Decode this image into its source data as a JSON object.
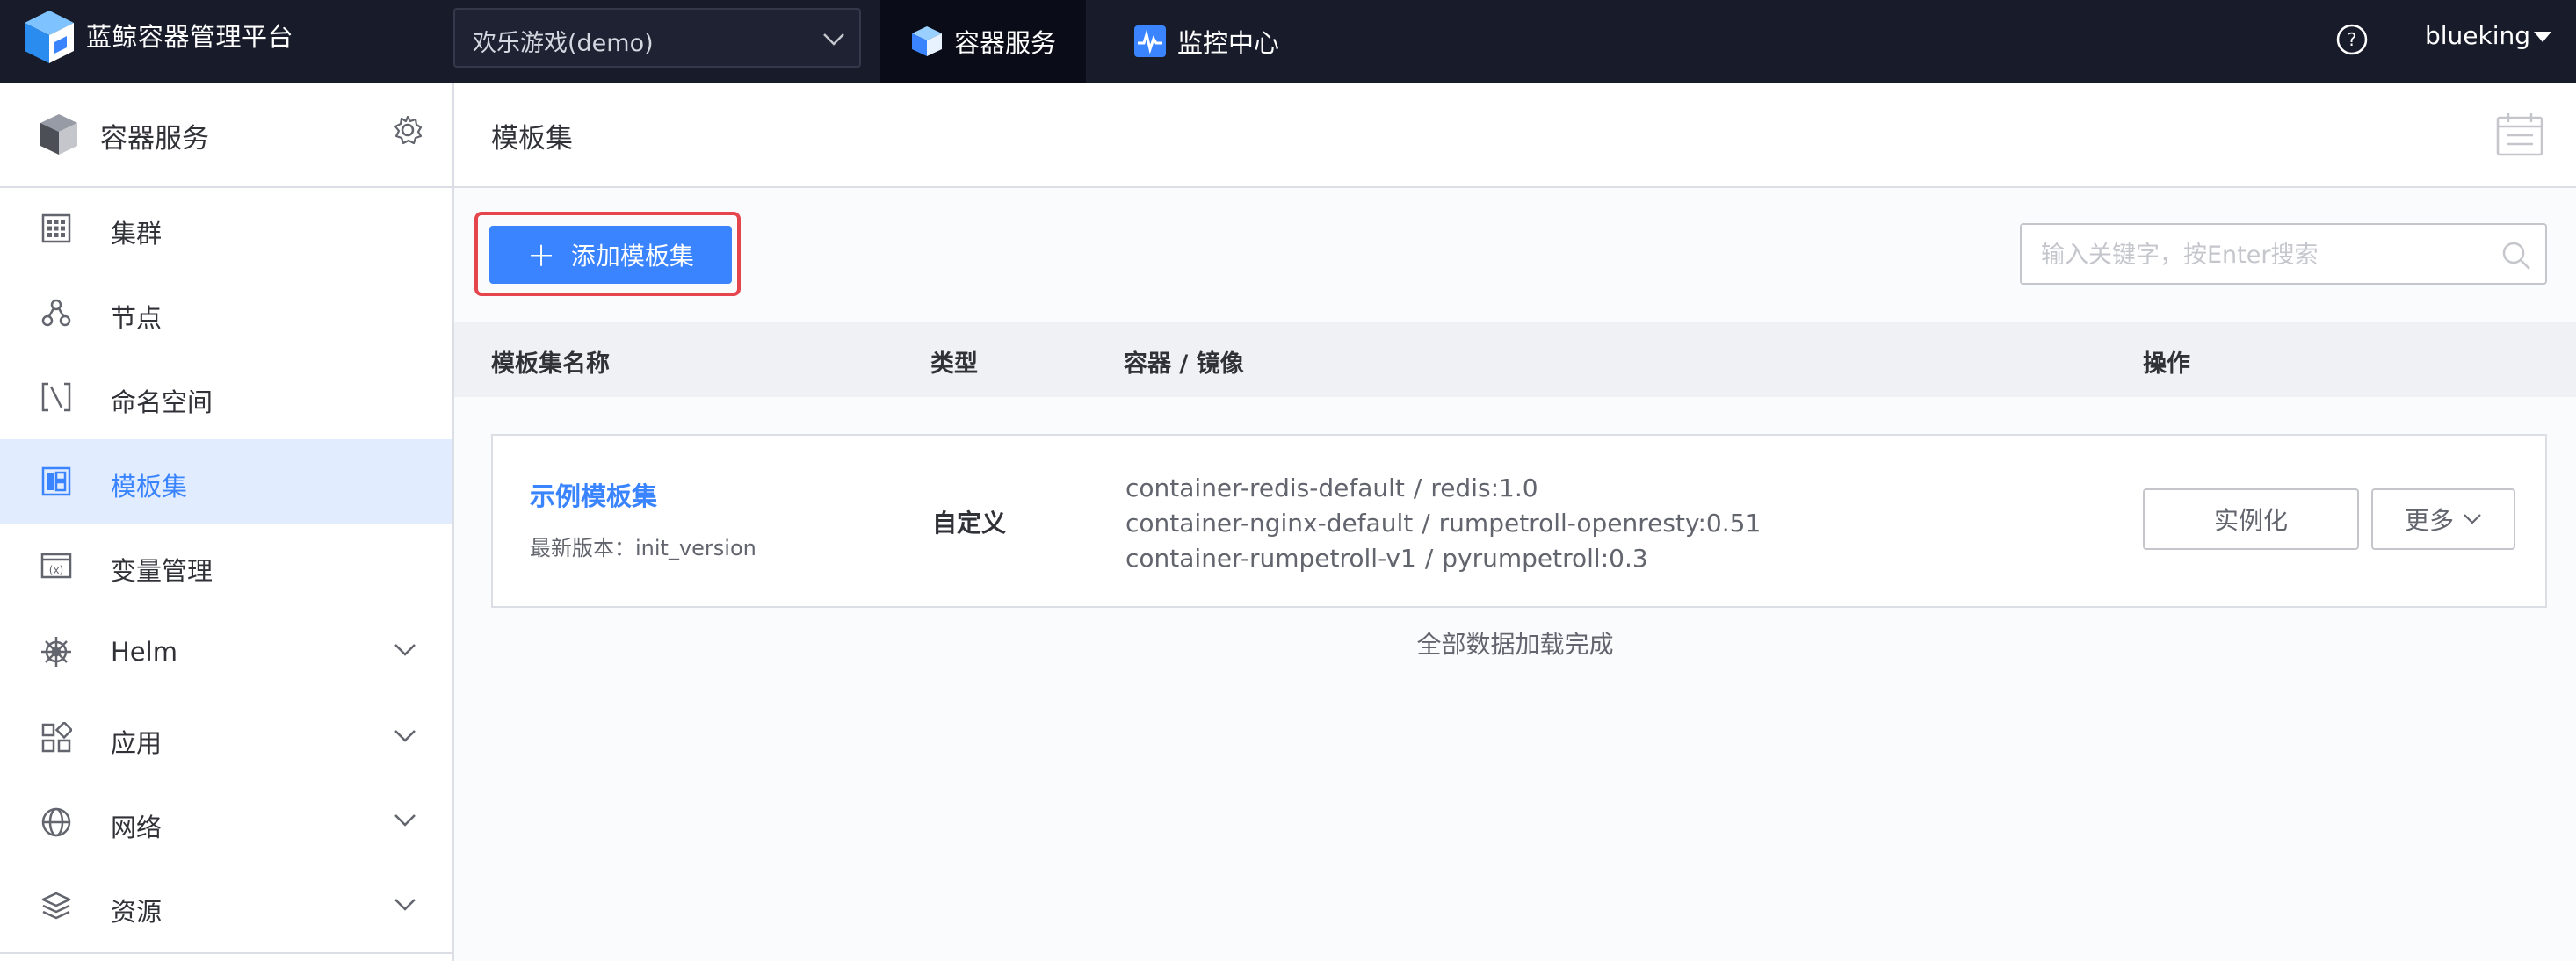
{
  "topbar": {
    "app_title": "蓝鲸容器管理平台",
    "project": "欢乐游戏(demo)",
    "tabs": [
      {
        "label": "容器服务",
        "active": true,
        "icon": "cube-icon"
      },
      {
        "label": "监控中心",
        "active": false,
        "icon": "monitor-pulse-icon"
      }
    ],
    "username": "blueking"
  },
  "sidebar": {
    "title": "容器服务",
    "items": [
      {
        "label": "集群",
        "icon": "cluster-grid-icon",
        "active": false,
        "expandable": false
      },
      {
        "label": "节点",
        "icon": "node-icon",
        "active": false,
        "expandable": false
      },
      {
        "label": "命名空间",
        "icon": "namespace-bracket-icon",
        "active": false,
        "expandable": false
      },
      {
        "label": "模板集",
        "icon": "template-icon",
        "active": true,
        "expandable": false
      },
      {
        "label": "变量管理",
        "icon": "variable-icon",
        "active": false,
        "expandable": false
      },
      {
        "label": "Helm",
        "icon": "helm-wheel-icon",
        "active": false,
        "expandable": true
      },
      {
        "label": "应用",
        "icon": "app-blocks-icon",
        "active": false,
        "expandable": true
      },
      {
        "label": "网络",
        "icon": "network-globe-icon",
        "active": false,
        "expandable": true
      },
      {
        "label": "资源",
        "icon": "resource-layers-icon",
        "active": false,
        "expandable": true
      }
    ]
  },
  "main": {
    "page_title": "模板集",
    "add_button": "添加模板集",
    "search_placeholder": "输入关键字，按Enter搜索",
    "columns": [
      "模板集名称",
      "类型",
      "容器 / 镜像",
      "操作"
    ],
    "rows": [
      {
        "name": "示例模板集",
        "version_label": "最新版本：init_version",
        "type": "自定义",
        "containers": [
          {
            "container": "container-redis-default",
            "image": "redis:1.0"
          },
          {
            "container": "container-nginx-default",
            "image": "rumpetroll-openresty:0.51"
          },
          {
            "container": "container-rumpetroll-v1",
            "image": "pyrumpetroll:0.3"
          }
        ],
        "actions": {
          "instantiate": "实例化",
          "more": "更多"
        }
      }
    ],
    "load_complete": "全部数据加载完成"
  },
  "colors": {
    "topbar_bg": "#181c2a",
    "primary": "#3a84ff",
    "active_menu_bg": "#e1ecff",
    "highlight_border": "#e5454d"
  }
}
